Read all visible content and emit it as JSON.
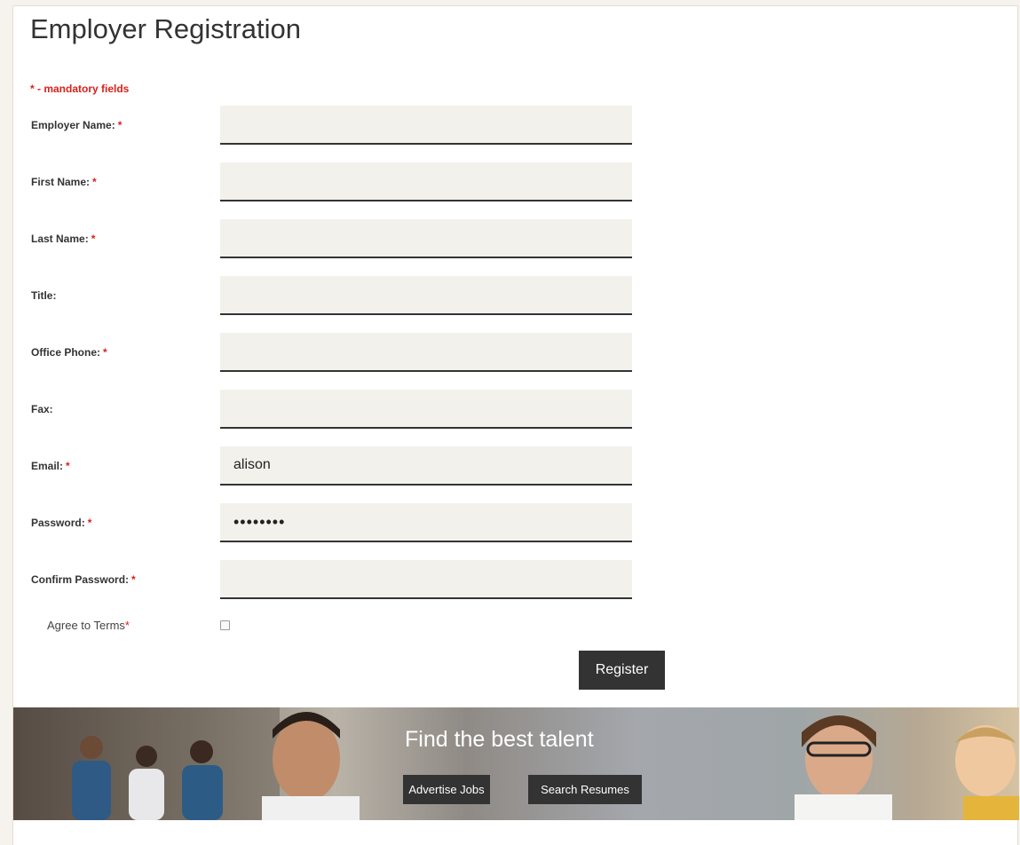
{
  "page": {
    "title": "Employer Registration",
    "mandatory_note": "* - mandatory fields"
  },
  "form": {
    "fields": [
      {
        "label": "Employer Name:",
        "required": true,
        "value": "",
        "type": "text"
      },
      {
        "label": "First Name:",
        "required": true,
        "value": "",
        "type": "text"
      },
      {
        "label": "Last Name:",
        "required": true,
        "value": "",
        "type": "text"
      },
      {
        "label": "Title:",
        "required": false,
        "value": "",
        "type": "text"
      },
      {
        "label": "Office Phone:",
        "required": true,
        "value": "",
        "type": "text"
      },
      {
        "label": "Fax:",
        "required": false,
        "value": "",
        "type": "text"
      },
      {
        "label": "Email:",
        "required": true,
        "value": "alison",
        "type": "text"
      },
      {
        "label": "Password:",
        "required": true,
        "value": "••••••••",
        "type": "password"
      },
      {
        "label": "Confirm Password:",
        "required": true,
        "value": "",
        "type": "password"
      }
    ],
    "required_marker": "*",
    "terms_label": "Agree to Terms",
    "terms_checked": false,
    "register_label": "Register"
  },
  "banner": {
    "title": "Find the best talent",
    "advertise_label": "Advertise Jobs",
    "search_label": "Search Resumes"
  },
  "colors": {
    "accent_red": "#d9201c",
    "button_dark": "#333333",
    "field_bg": "#f3f1ec"
  }
}
